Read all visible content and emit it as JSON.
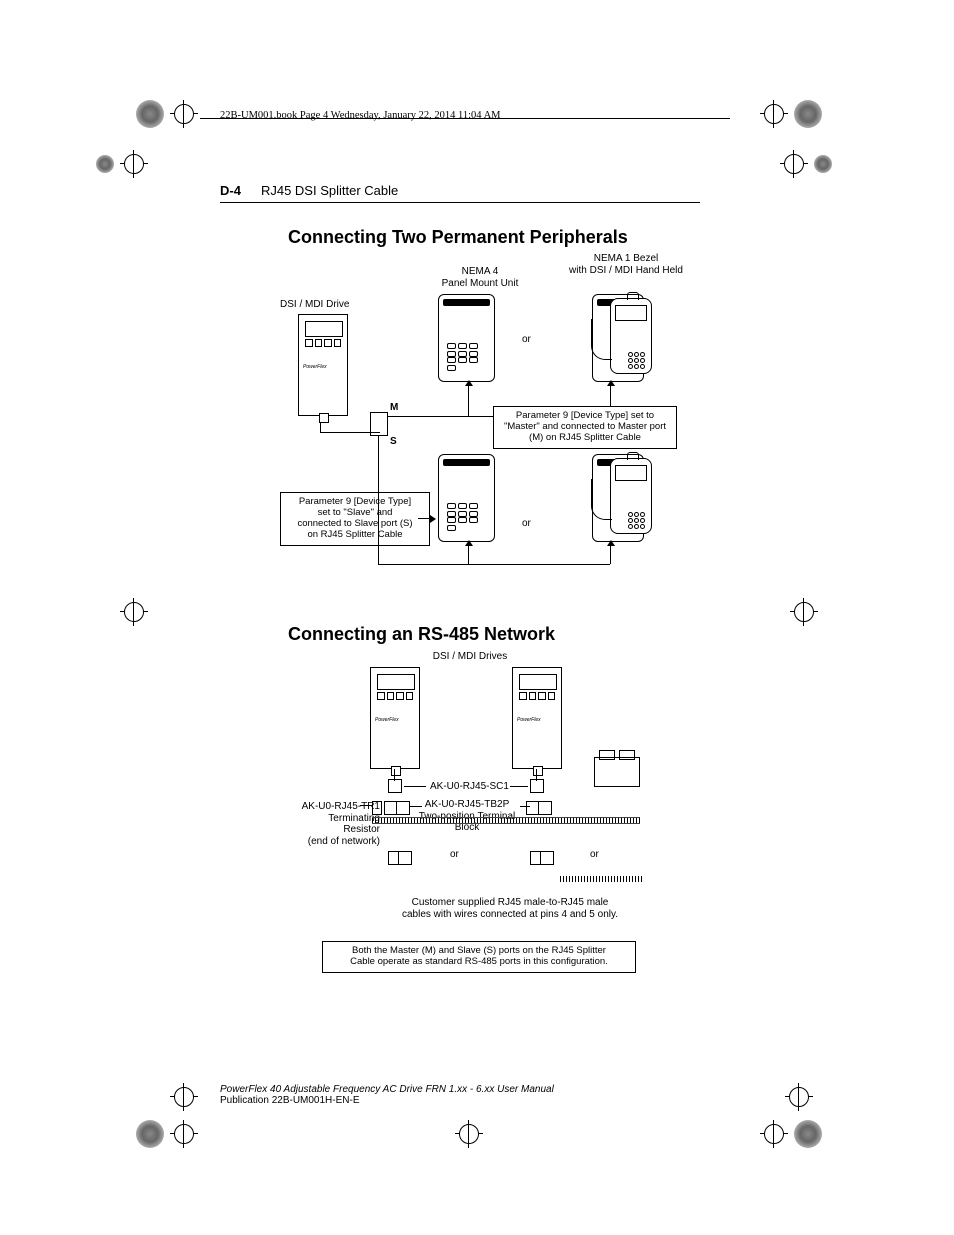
{
  "running_head": "22B-UM001.book  Page 4  Wednesday, January 22, 2014  11:04 AM",
  "page": {
    "number": "D-4",
    "chapter": "RJ45 DSI Splitter Cable"
  },
  "section1": {
    "title": "Connecting Two Permanent Peripherals",
    "labels": {
      "drive": "DSI / MDI Drive",
      "nema4_l1": "NEMA 4",
      "nema4_l2": "Panel Mount Unit",
      "nema1_l1": "NEMA 1 Bezel",
      "nema1_l2": "with DSI / MDI Hand Held",
      "or1": "or",
      "or2": "or",
      "m": "M",
      "s": "S",
      "master_note": "Parameter 9 [Device Type] set to \"Master\" and connected to Master port (M) on RJ45 Splitter Cable",
      "slave_l1": "Parameter 9 [Device Type]",
      "slave_l2": "set to \"Slave\" and",
      "slave_l3": "connected to Slave port (S)",
      "slave_l4": "on RJ45 Splitter Cable"
    }
  },
  "section2": {
    "title": "Connecting an RS-485 Network",
    "labels": {
      "drives": "DSI / MDI Drives",
      "sc1": "AK-U0-RJ45-SC1",
      "tb2p": "AK-U0-RJ45-TB2P",
      "tb2p_sub": "Two-position Terminal Block",
      "tr1": "AK-U0-RJ45-TR1",
      "tr1_sub1": "Terminating Resistor",
      "tr1_sub2": "(end of network)",
      "or1": "or",
      "or2": "or",
      "customer_l1": "Customer supplied RJ45 male-to-RJ45 male",
      "customer_l2": "cables with wires connected at pins 4 and 5 only.",
      "both_note_l1": "Both the Master (M) and Slave (S) ports on the RJ45 Splitter",
      "both_note_l2": "Cable operate as standard RS-485 ports in this configuration."
    }
  },
  "footer": {
    "line1": "PowerFlex 40 Adjustable Frequency AC Drive FRN 1.xx - 6.xx User Manual",
    "line2": "Publication 22B-UM001H-EN-E"
  }
}
